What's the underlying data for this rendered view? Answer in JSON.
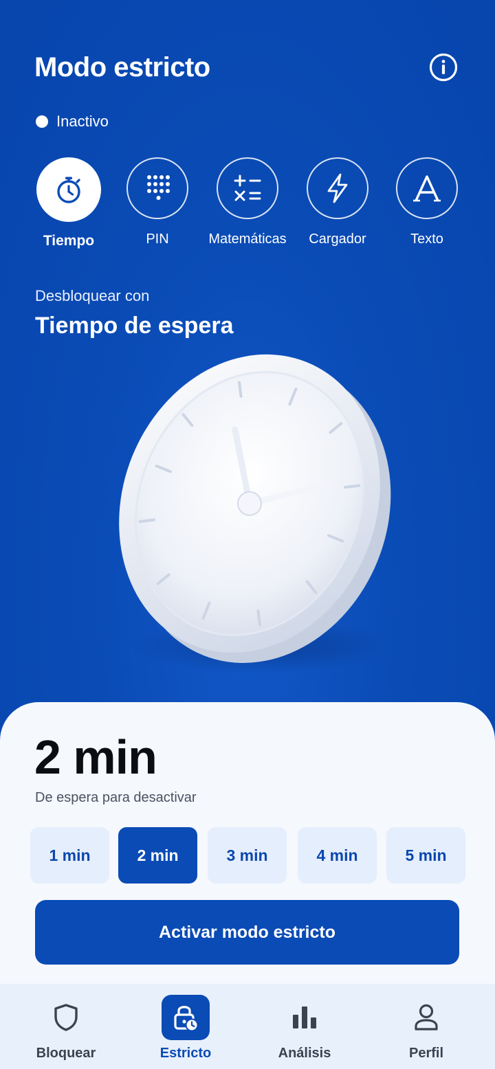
{
  "header": {
    "title": "Modo estricto",
    "info_icon": "info-circle-icon"
  },
  "status": {
    "label": "Inactivo",
    "color": "#ffffff"
  },
  "unlock_methods": [
    {
      "label": "Tiempo",
      "icon": "stopwatch-icon",
      "active": true
    },
    {
      "label": "PIN",
      "icon": "keypad-icon",
      "active": false
    },
    {
      "label": "Matemáticas",
      "icon": "math-operators-icon",
      "active": false
    },
    {
      "label": "Cargador",
      "icon": "lightning-icon",
      "active": false
    },
    {
      "label": "Texto",
      "icon": "letter-a-icon",
      "active": false
    }
  ],
  "unlock": {
    "caption": "Desbloquear con",
    "method_title": "Tiempo de espera",
    "illustration": "wall-clock-illustration"
  },
  "sheet": {
    "selected_time": "2 min",
    "caption": "De espera para desactivar",
    "options": [
      {
        "label": "1 min",
        "selected": false
      },
      {
        "label": "2 min",
        "selected": true
      },
      {
        "label": "3 min",
        "selected": false
      },
      {
        "label": "4 min",
        "selected": false
      },
      {
        "label": "5 min",
        "selected": false
      }
    ],
    "activate_label": "Activar modo estricto"
  },
  "tabbar": {
    "items": [
      {
        "label": "Bloquear",
        "icon": "shield-icon",
        "active": false
      },
      {
        "label": "Estricto",
        "icon": "lock-clock-icon",
        "active": true
      },
      {
        "label": "Análisis",
        "icon": "bar-chart-icon",
        "active": false
      },
      {
        "label": "Perfil",
        "icon": "user-icon",
        "active": false
      }
    ]
  },
  "colors": {
    "primary": "#0a4bb5",
    "sheet_background": "#f5f8fd",
    "option_background": "#e5eefc",
    "tabbar_background": "#e8f0fc"
  }
}
